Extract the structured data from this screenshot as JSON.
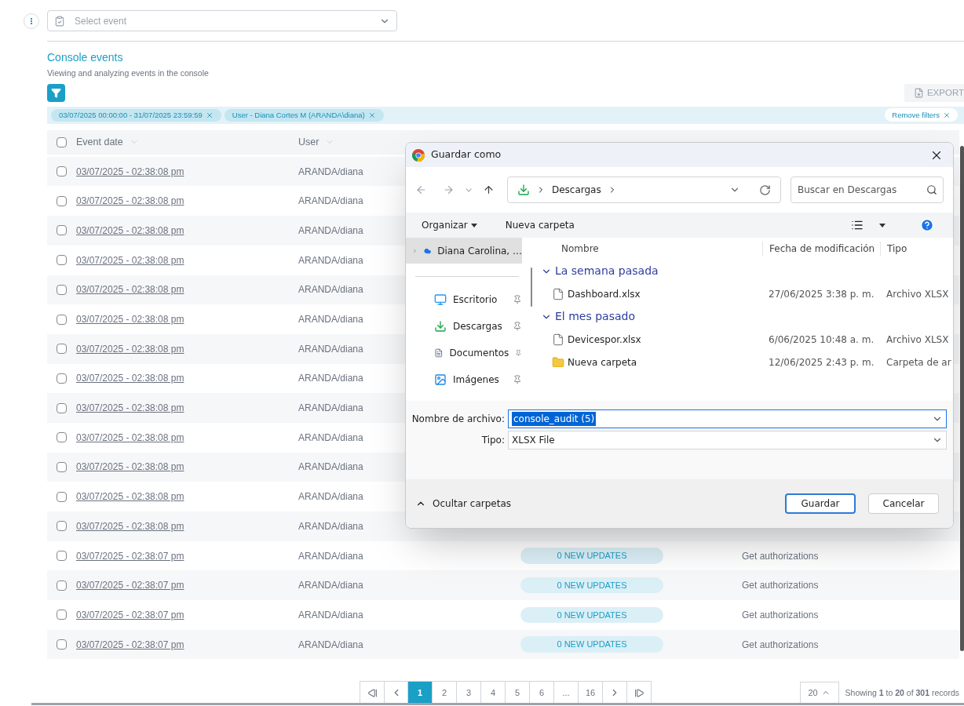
{
  "event_select": {
    "placeholder": "Select event"
  },
  "section": {
    "title": "Console events",
    "subtitle": "Viewing and analyzing events in the console"
  },
  "export_button": "EXPORT",
  "filters": [
    {
      "label": "03/07/2025 00:00:00 - 31/07/2025 23:59:59"
    },
    {
      "label": "User - Diana Cortes M (ARANDA\\diana)"
    }
  ],
  "remove_filters": "Remove filters",
  "table": {
    "select_all_checked": false,
    "columns": [
      "Event date",
      "User"
    ],
    "rows": [
      {
        "date": "03/07/2025 - 02:38:08 pm",
        "user": "ARANDA/diana",
        "checked": false
      },
      {
        "date": "03/07/2025 - 02:38:08 pm",
        "user": "ARANDA/diana",
        "checked": false
      },
      {
        "date": "03/07/2025 - 02:38:08 pm",
        "user": "ARANDA/diana",
        "checked": false
      },
      {
        "date": "03/07/2025 - 02:38:08 pm",
        "user": "ARANDA/diana",
        "checked": false
      },
      {
        "date": "03/07/2025 - 02:38:08 pm",
        "user": "ARANDA/diana",
        "checked": false
      },
      {
        "date": "03/07/2025 - 02:38:08 pm",
        "user": "ARANDA/diana",
        "checked": false
      },
      {
        "date": "03/07/2025 - 02:38:08 pm",
        "user": "ARANDA/diana",
        "checked": false
      },
      {
        "date": "03/07/2025 - 02:38:08 pm",
        "user": "ARANDA/diana",
        "checked": false
      },
      {
        "date": "03/07/2025 - 02:38:08 pm",
        "user": "ARANDA/diana",
        "checked": false
      },
      {
        "date": "03/07/2025 - 02:38:08 pm",
        "user": "ARANDA/diana",
        "checked": false
      },
      {
        "date": "03/07/2025 - 02:38:08 pm",
        "user": "ARANDA/diana",
        "checked": false
      },
      {
        "date": "03/07/2025 - 02:38:08 pm",
        "user": "ARANDA/diana",
        "checked": false
      },
      {
        "date": "03/07/2025 - 02:38:08 pm",
        "user": "ARANDA/diana",
        "checked": false
      },
      {
        "date": "03/07/2025 - 02:38:07 pm",
        "user": "ARANDA/diana",
        "checked": false,
        "operation": "0 NEW UPDATES",
        "action": "Get authorizations"
      },
      {
        "date": "03/07/2025 - 02:38:07 pm",
        "user": "ARANDA/diana",
        "checked": false,
        "operation": "0 NEW UPDATES",
        "action": "Get authorizations"
      },
      {
        "date": "03/07/2025 - 02:38:07 pm",
        "user": "ARANDA/diana",
        "checked": false,
        "operation": "0 NEW UPDATES",
        "action": "Get authorizations"
      },
      {
        "date": "03/07/2025 - 02:38:07 pm",
        "user": "ARANDA/diana",
        "checked": false,
        "operation": "0 NEW UPDATES",
        "action": "Get authorizations"
      }
    ]
  },
  "pagination": {
    "pages": [
      {
        "label": "1",
        "selected": true
      },
      {
        "label": "2",
        "selected": false
      },
      {
        "label": "3",
        "selected": false
      },
      {
        "label": "4",
        "selected": false
      },
      {
        "label": "5",
        "selected": false
      },
      {
        "label": "6",
        "selected": false
      },
      {
        "label": "...",
        "selected": false
      },
      {
        "label": "16",
        "selected": false
      }
    ],
    "page_size": "20",
    "summary": "Showing **1** to **20** of **301** records"
  },
  "dialog": {
    "title": "Guardar como",
    "breadcrumb": "Descargas",
    "search_placeholder": "Buscar en Descargas",
    "toolbar": {
      "organize": "Organizar",
      "new_folder": "Nueva carpeta"
    },
    "nav_items": [
      {
        "label": "Diana Carolina, …",
        "kind": "cloud",
        "selected": true
      },
      {
        "label": "Escritorio",
        "kind": "desktop",
        "selected": false
      },
      {
        "label": "Descargas",
        "kind": "download",
        "selected": false
      },
      {
        "label": "Documentos",
        "kind": "documents",
        "selected": false
      },
      {
        "label": "Imágenes",
        "kind": "images",
        "selected": false
      }
    ],
    "columns": [
      "Nombre",
      "Fecha de modificación",
      "Tipo"
    ],
    "groups": [
      {
        "label": "La semana pasada",
        "expanded": true,
        "children": [
          {
            "name": "Dashboard.xlsx",
            "kind": "file",
            "modified": "27/06/2025 3:38 p. m.",
            "type": "Archivo XLSX"
          }
        ]
      },
      {
        "label": "El mes pasado",
        "expanded": true,
        "children": [
          {
            "name": "Devicespor.xlsx",
            "kind": "file",
            "modified": "6/06/2025 10:48 a. m.",
            "type": "Archivo XLSX"
          },
          {
            "name": "Nueva carpeta",
            "kind": "folder",
            "modified": "12/06/2025 2:43 p. m.",
            "type": "Carpeta de ar"
          }
        ]
      }
    ],
    "filename_label": "Nombre de archivo:",
    "filename": "console_audit (5)",
    "type_label": "Tipo:",
    "type_value": "XLSX File",
    "hide_folders": "Ocultar carpetas",
    "save": "Guardar",
    "cancel": "Cancelar"
  }
}
